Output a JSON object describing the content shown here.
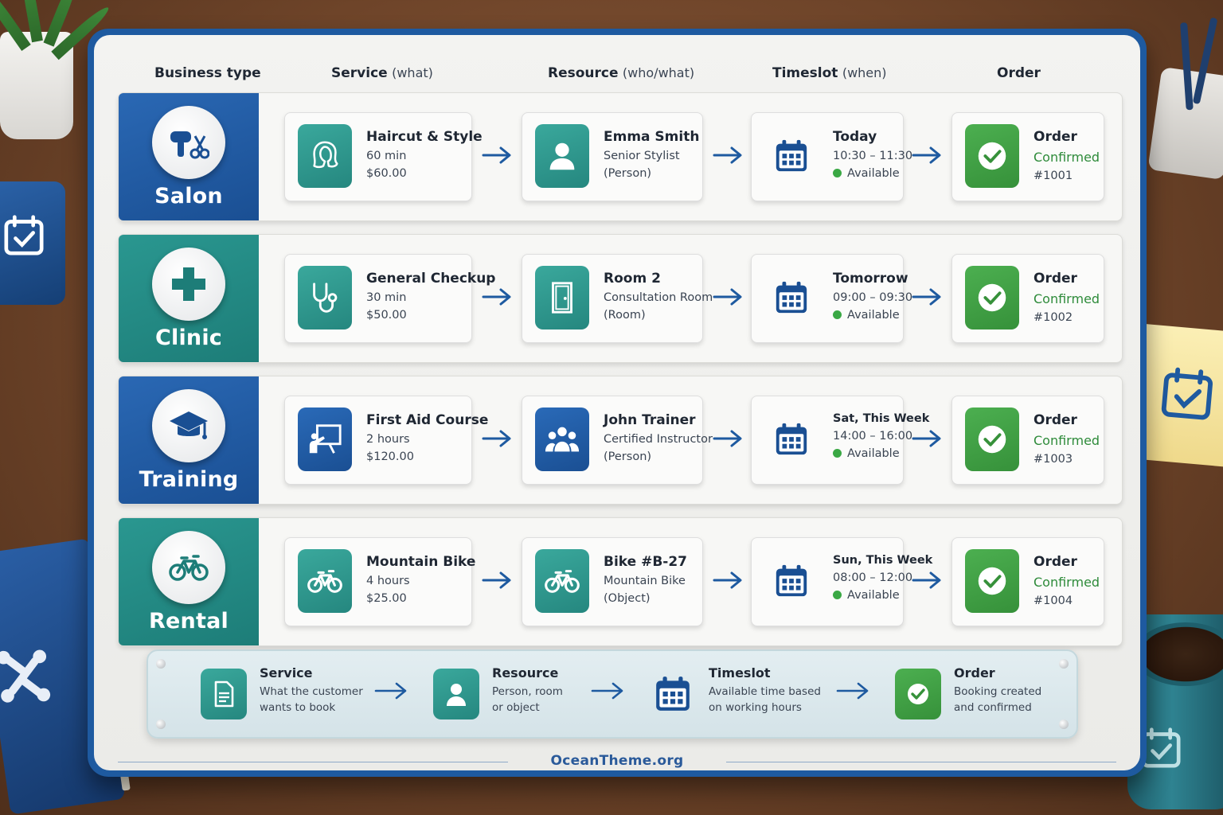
{
  "header": {
    "business_type": "Business type",
    "service": "Service",
    "service_sub": "(what)",
    "resource": "Resource",
    "resource_sub": "(who/what)",
    "timeslot": "Timeslot",
    "timeslot_sub": "(when)",
    "order": "Order"
  },
  "rows": [
    {
      "business": "Salon",
      "service": {
        "name": "Haircut & Style",
        "duration": "60 min",
        "price": "$60.00"
      },
      "resource": {
        "name": "Emma Smith",
        "role": "Senior Stylist",
        "kind": "(Person)"
      },
      "timeslot": {
        "day": "Today",
        "time": "10:30 – 11:30",
        "status": "Available"
      },
      "order": {
        "label": "Order",
        "status": "Confirmed",
        "number": "#1001"
      }
    },
    {
      "business": "Clinic",
      "service": {
        "name": "General Checkup",
        "duration": "30 min",
        "price": "$50.00"
      },
      "resource": {
        "name": "Room 2",
        "role": "Consultation Room",
        "kind": "(Room)"
      },
      "timeslot": {
        "day": "Tomorrow",
        "time": "09:00 – 09:30",
        "status": "Available"
      },
      "order": {
        "label": "Order",
        "status": "Confirmed",
        "number": "#1002"
      }
    },
    {
      "business": "Training",
      "service": {
        "name": "First Aid Course",
        "duration": "2 hours",
        "price": "$120.00"
      },
      "resource": {
        "name": "John Trainer",
        "role": "Certified Instructor",
        "kind": "(Person)"
      },
      "timeslot": {
        "day": "Sat, This Week",
        "time": "14:00 – 16:00",
        "status": "Available"
      },
      "order": {
        "label": "Order",
        "status": "Confirmed",
        "number": "#1003"
      }
    },
    {
      "business": "Rental",
      "service": {
        "name": "Mountain Bike",
        "duration": "4 hours",
        "price": "$25.00"
      },
      "resource": {
        "name": "Bike #B-27",
        "role": "Mountain Bike",
        "kind": "(Object)"
      },
      "timeslot": {
        "day": "Sun, This Week",
        "time": "08:00 – 12:00",
        "status": "Available"
      },
      "order": {
        "label": "Order",
        "status": "Confirmed",
        "number": "#1004"
      }
    }
  ],
  "legend": [
    {
      "title": "Service",
      "line1": "What the customer",
      "line2": "wants to book"
    },
    {
      "title": "Resource",
      "line1": "Person, room",
      "line2": "or object"
    },
    {
      "title": "Timeslot",
      "line1": "Available time based",
      "line2": "on working hours"
    },
    {
      "title": "Order",
      "line1": "Booking created",
      "line2": "and confirmed"
    }
  ],
  "footer": {
    "site": "OceanTheme.org"
  },
  "colors": {
    "brand_blue": "#1e5aa0",
    "teal": "#2a9790",
    "confirmed_green": "#2e8b3a",
    "available_dot": "#3aa844"
  },
  "icons": {
    "salon": "hairdryer-scissors-icon",
    "clinic": "medical-cross-icon",
    "training": "graduation-cap-icon",
    "rental": "bicycle-icon"
  }
}
